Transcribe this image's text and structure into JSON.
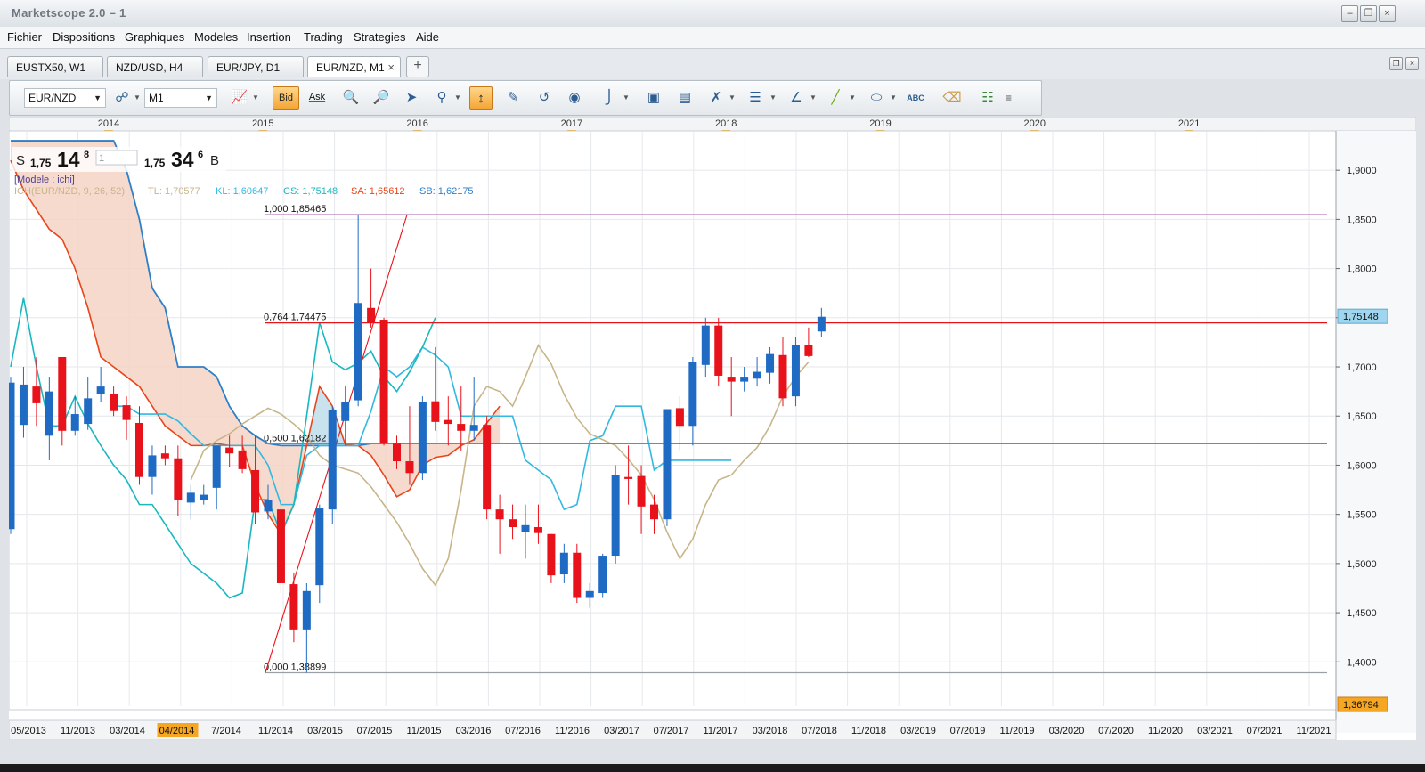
{
  "window": {
    "title": "Marketscope 2.0 – 1"
  },
  "menu": [
    "Fichier",
    "Dispositions",
    "Graphiques",
    "Modeles",
    "Insertion",
    "Trading",
    "Strategies",
    "Aide"
  ],
  "tabs": [
    {
      "label": "EUSTX50, W1"
    },
    {
      "label": "NZD/USD, H4"
    },
    {
      "label": "EUR/JPY, D1"
    },
    {
      "label": "EUR/NZD, M1",
      "active": true,
      "close": "×"
    }
  ],
  "tab_add": "+",
  "toolbar": {
    "symbol": "EUR/NZD",
    "timeframe": "M1",
    "bid": "Bid",
    "ask": "Ask"
  },
  "quote": {
    "sell_label": "S",
    "sell_prefix": "1,75",
    "sell_big": "14",
    "sell_sup": "8",
    "amount": "1",
    "buy_prefix": "1,75",
    "buy_big": "34",
    "buy_sup": "6",
    "buy_label": "B"
  },
  "legend": {
    "model": "[Modele : ichi]",
    "ich": "ICH(EUR/NZD, 9, 26, 52)",
    "tl": "TL: 1,70577",
    "kl": "KL: 1,60647",
    "cs": "CS: 1,75148",
    "sa": "SA: 1,65612",
    "sb": "SB: 1,62175"
  },
  "fib": [
    {
      "label": "1,000 1,85465",
      "value": 1.85465
    },
    {
      "label": "0,764 1,74475",
      "value": 1.74475
    },
    {
      "label": "0,500 1,62182",
      "value": 1.62182
    },
    {
      "label": "0,000 1,38899",
      "value": 1.38899
    }
  ],
  "price_badges": {
    "current": "1,75148",
    "low": "1,36794"
  },
  "colors": {
    "bull": "#1f6bc4",
    "bear": "#e8121b",
    "tenkan": "#c8b58a",
    "kijun": "#32b8e0",
    "chikou": "#19b8c0",
    "senkou_a": "#e8451a",
    "senkou_b": "#2e7fc7",
    "cloud_bear": "#f5d3c5",
    "cloud_bull": "#c8e2ee",
    "fib_top": "#8a2a8a",
    "fib_mid": "#e8121b",
    "fib_low": "#2fbf3a"
  },
  "chart_data": {
    "type": "candlestick",
    "symbol": "EUR/NZD",
    "timeframe": "M1",
    "y_ticks": [
      "1,9000",
      "1,8500",
      "1,8000",
      "1,7500",
      "1,7000",
      "1,6500",
      "1,6000",
      "1,5500",
      "1,5000",
      "1,4500",
      "1,4000"
    ],
    "ylim": [
      1.355,
      1.94
    ],
    "year_labels": [
      "2014",
      "2015",
      "2016",
      "2017",
      "2018",
      "2019",
      "2020",
      "2021"
    ],
    "x_labels": [
      "05/2013",
      "11/2013",
      "03/2014",
      "04/2014",
      "7/2014",
      "11/2014",
      "03/2015",
      "07/2015",
      "11/2015",
      "03/2016",
      "07/2016",
      "11/2016",
      "03/2017",
      "07/2017",
      "11/2017",
      "03/2018",
      "07/2018",
      "11/2018",
      "03/2019",
      "07/2019",
      "11/2019",
      "03/2020",
      "07/2020",
      "11/2020",
      "03/2021",
      "07/2021",
      "11/2021"
    ],
    "highlighted_x_label": "04/2014",
    "candles": [
      {
        "o": 1.535,
        "h": 1.69,
        "l": 1.53,
        "c": 1.684
      },
      {
        "o": 1.641,
        "h": 1.7,
        "l": 1.628,
        "c": 1.682
      },
      {
        "o": 1.68,
        "h": 1.71,
        "l": 1.64,
        "c": 1.663
      },
      {
        "o": 1.63,
        "h": 1.69,
        "l": 1.605,
        "c": 1.675
      },
      {
        "o": 1.71,
        "h": 1.71,
        "l": 1.62,
        "c": 1.635
      },
      {
        "o": 1.635,
        "h": 1.67,
        "l": 1.63,
        "c": 1.652
      },
      {
        "o": 1.642,
        "h": 1.69,
        "l": 1.636,
        "c": 1.668
      },
      {
        "o": 1.672,
        "h": 1.7,
        "l": 1.664,
        "c": 1.68
      },
      {
        "o": 1.672,
        "h": 1.68,
        "l": 1.65,
        "c": 1.655
      },
      {
        "o": 1.661,
        "h": 1.67,
        "l": 1.626,
        "c": 1.646
      },
      {
        "o": 1.643,
        "h": 1.66,
        "l": 1.58,
        "c": 1.588
      },
      {
        "o": 1.588,
        "h": 1.62,
        "l": 1.57,
        "c": 1.61
      },
      {
        "o": 1.612,
        "h": 1.62,
        "l": 1.6,
        "c": 1.607
      },
      {
        "o": 1.607,
        "h": 1.62,
        "l": 1.548,
        "c": 1.565
      },
      {
        "o": 1.562,
        "h": 1.58,
        "l": 1.545,
        "c": 1.572
      },
      {
        "o": 1.565,
        "h": 1.58,
        "l": 1.56,
        "c": 1.57
      },
      {
        "o": 1.577,
        "h": 1.62,
        "l": 1.555,
        "c": 1.62
      },
      {
        "o": 1.618,
        "h": 1.63,
        "l": 1.598,
        "c": 1.612
      },
      {
        "o": 1.615,
        "h": 1.63,
        "l": 1.592,
        "c": 1.596
      },
      {
        "o": 1.595,
        "h": 1.63,
        "l": 1.54,
        "c": 1.552
      },
      {
        "o": 1.553,
        "h": 1.58,
        "l": 1.545,
        "c": 1.565
      },
      {
        "o": 1.555,
        "h": 1.56,
        "l": 1.47,
        "c": 1.48
      },
      {
        "o": 1.479,
        "h": 1.49,
        "l": 1.42,
        "c": 1.433
      },
      {
        "o": 1.433,
        "h": 1.48,
        "l": 1.389,
        "c": 1.472
      },
      {
        "o": 1.478,
        "h": 1.56,
        "l": 1.46,
        "c": 1.556
      },
      {
        "o": 1.555,
        "h": 1.66,
        "l": 1.54,
        "c": 1.656
      },
      {
        "o": 1.645,
        "h": 1.68,
        "l": 1.62,
        "c": 1.664
      },
      {
        "o": 1.666,
        "h": 1.855,
        "l": 1.66,
        "c": 1.765
      },
      {
        "o": 1.76,
        "h": 1.8,
        "l": 1.74,
        "c": 1.745
      },
      {
        "o": 1.748,
        "h": 1.75,
        "l": 1.62,
        "c": 1.622
      },
      {
        "o": 1.622,
        "h": 1.63,
        "l": 1.596,
        "c": 1.604
      },
      {
        "o": 1.604,
        "h": 1.66,
        "l": 1.58,
        "c": 1.592
      },
      {
        "o": 1.592,
        "h": 1.67,
        "l": 1.585,
        "c": 1.664
      },
      {
        "o": 1.665,
        "h": 1.72,
        "l": 1.635,
        "c": 1.644
      },
      {
        "o": 1.646,
        "h": 1.67,
        "l": 1.62,
        "c": 1.642
      },
      {
        "o": 1.642,
        "h": 1.68,
        "l": 1.615,
        "c": 1.635
      },
      {
        "o": 1.635,
        "h": 1.69,
        "l": 1.625,
        "c": 1.641
      },
      {
        "o": 1.641,
        "h": 1.65,
        "l": 1.545,
        "c": 1.555
      },
      {
        "o": 1.555,
        "h": 1.57,
        "l": 1.51,
        "c": 1.545
      },
      {
        "o": 1.545,
        "h": 1.56,
        "l": 1.525,
        "c": 1.537
      },
      {
        "o": 1.532,
        "h": 1.56,
        "l": 1.505,
        "c": 1.539
      },
      {
        "o": 1.537,
        "h": 1.56,
        "l": 1.52,
        "c": 1.531
      },
      {
        "o": 1.53,
        "h": 1.53,
        "l": 1.48,
        "c": 1.488
      },
      {
        "o": 1.489,
        "h": 1.52,
        "l": 1.48,
        "c": 1.511
      },
      {
        "o": 1.511,
        "h": 1.52,
        "l": 1.46,
        "c": 1.465
      },
      {
        "o": 1.465,
        "h": 1.48,
        "l": 1.455,
        "c": 1.472
      },
      {
        "o": 1.47,
        "h": 1.51,
        "l": 1.465,
        "c": 1.508
      },
      {
        "o": 1.508,
        "h": 1.6,
        "l": 1.5,
        "c": 1.59
      },
      {
        "o": 1.588,
        "h": 1.62,
        "l": 1.56,
        "c": 1.586
      },
      {
        "o": 1.589,
        "h": 1.6,
        "l": 1.53,
        "c": 1.558
      },
      {
        "o": 1.56,
        "h": 1.57,
        "l": 1.53,
        "c": 1.545
      },
      {
        "o": 1.545,
        "h": 1.62,
        "l": 1.538,
        "c": 1.657
      },
      {
        "o": 1.658,
        "h": 1.67,
        "l": 1.615,
        "c": 1.64
      },
      {
        "o": 1.64,
        "h": 1.71,
        "l": 1.62,
        "c": 1.705
      },
      {
        "o": 1.702,
        "h": 1.75,
        "l": 1.69,
        "c": 1.742
      },
      {
        "o": 1.742,
        "h": 1.75,
        "l": 1.68,
        "c": 1.691
      },
      {
        "o": 1.69,
        "h": 1.71,
        "l": 1.65,
        "c": 1.685
      },
      {
        "o": 1.685,
        "h": 1.7,
        "l": 1.675,
        "c": 1.69
      },
      {
        "o": 1.688,
        "h": 1.71,
        "l": 1.68,
        "c": 1.695
      },
      {
        "o": 1.694,
        "h": 1.72,
        "l": 1.683,
        "c": 1.713
      },
      {
        "o": 1.712,
        "h": 1.73,
        "l": 1.66,
        "c": 1.668
      },
      {
        "o": 1.67,
        "h": 1.73,
        "l": 1.66,
        "c": 1.722
      },
      {
        "o": 1.722,
        "h": 1.74,
        "l": 1.71,
        "c": 1.711
      },
      {
        "o": 1.736,
        "h": 1.76,
        "l": 1.73,
        "c": 1.751
      }
    ],
    "tenkan": [
      1.585,
      1.615,
      1.625,
      1.632,
      1.642,
      1.65,
      1.658,
      1.652,
      1.642,
      1.63,
      1.61,
      1.6,
      1.596,
      1.592,
      1.578,
      1.56,
      1.542,
      1.52,
      1.495,
      1.478,
      1.505,
      1.575,
      1.66,
      1.68,
      1.675,
      1.66,
      1.69,
      1.722,
      1.703,
      1.672,
      1.648,
      1.632,
      1.626,
      1.62,
      1.606,
      1.59,
      1.565,
      1.532,
      1.505,
      1.525,
      1.56,
      1.585,
      1.59,
      1.605,
      1.618,
      1.64,
      1.67,
      1.69,
      1.705
    ],
    "kijun": [
      1.66,
      1.66,
      1.652,
      1.652,
      1.652,
      1.645,
      1.632,
      1.62,
      1.62,
      1.62,
      1.62,
      1.62,
      1.6,
      1.56,
      1.56,
      1.61,
      1.62,
      1.62,
      1.62,
      1.62,
      1.655,
      1.7,
      1.69,
      1.7,
      1.72,
      1.712,
      1.7,
      1.65,
      1.65,
      1.65,
      1.65,
      1.65,
      1.605,
      1.595,
      1.585,
      1.555,
      1.56,
      1.625,
      1.63,
      1.66,
      1.66,
      1.66,
      1.595,
      1.605,
      1.605,
      1.605,
      1.605,
      1.605,
      1.605
    ],
    "chikou": [
      1.7,
      1.77,
      1.7,
      1.64,
      1.64,
      1.67,
      1.642,
      1.62,
      1.6,
      1.585,
      1.56,
      1.56,
      1.54,
      1.52,
      1.5,
      1.49,
      1.48,
      1.465,
      1.47,
      1.565,
      1.565,
      1.53,
      1.56,
      1.65,
      1.745,
      1.705,
      1.697,
      1.704,
      1.716,
      1.69,
      1.675,
      1.695,
      1.72,
      1.75
    ],
    "senkou_a": [
      1.91,
      1.88,
      1.86,
      1.84,
      1.83,
      1.8,
      1.76,
      1.71,
      1.7,
      1.69,
      1.68,
      1.66,
      1.64,
      1.63,
      1.62,
      1.62,
      1.622,
      1.62,
      1.62,
      1.58,
      1.55,
      1.53,
      1.56,
      1.62,
      1.68,
      1.66,
      1.621,
      1.62,
      1.61,
      1.59,
      1.568,
      1.575,
      1.6,
      1.608,
      1.61,
      1.62,
      1.626,
      1.643,
      1.66
    ],
    "senkou_b": [
      1.93,
      1.93,
      1.93,
      1.93,
      1.93,
      1.93,
      1.93,
      1.93,
      1.93,
      1.9,
      1.85,
      1.78,
      1.76,
      1.7,
      1.7,
      1.7,
      1.69,
      1.66,
      1.64,
      1.63,
      1.622,
      1.62,
      1.62,
      1.62,
      1.62,
      1.62,
      1.62,
      1.62,
      1.622,
      1.622,
      1.622,
      1.622,
      1.622,
      1.622,
      1.622,
      1.622,
      1.622,
      1.622,
      1.622
    ]
  }
}
